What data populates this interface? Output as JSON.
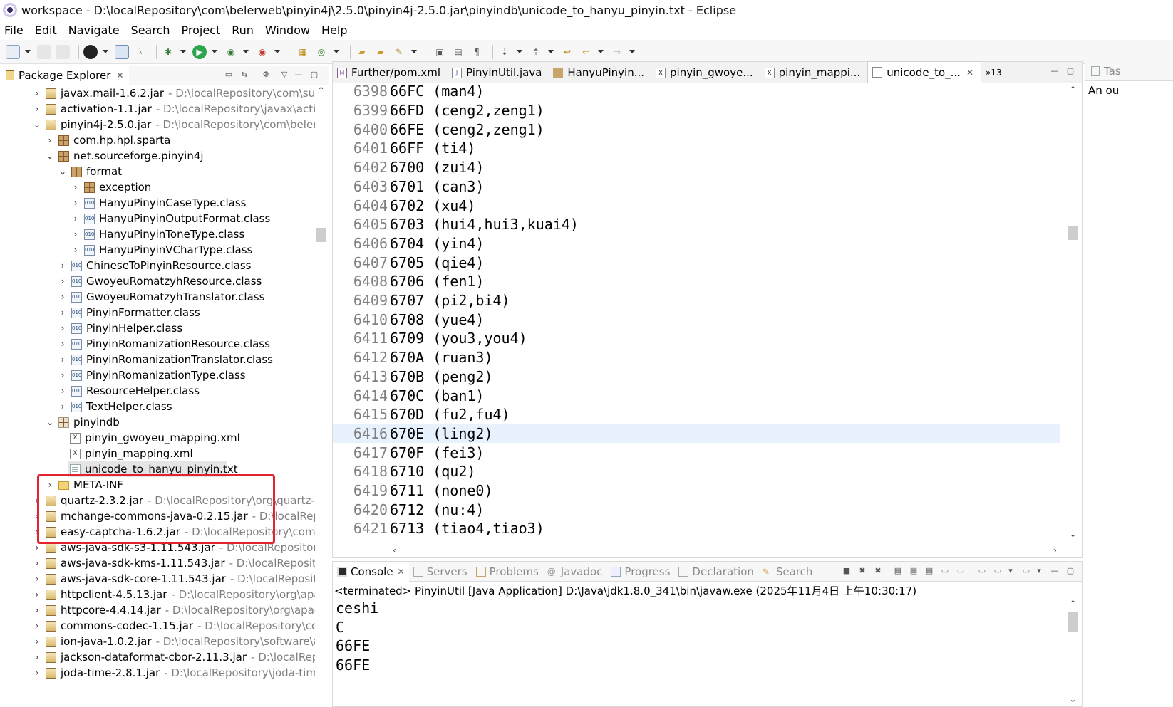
{
  "window": {
    "title": "workspace - D:\\localRepository\\com\\belerweb\\pinyin4j\\2.5.0\\pinyin4j-2.5.0.jar\\pinyindb\\unicode_to_hanyu_pinyin.txt - Eclipse"
  },
  "menu": [
    "File",
    "Edit",
    "Navigate",
    "Search",
    "Project",
    "Run",
    "Window",
    "Help"
  ],
  "package_explorer": {
    "title": "Package Explorer",
    "rows": [
      {
        "label": "javax.mail-1.6.2.jar",
        "path": "- D:\\localRepository\\com\\sun\\ma"
      },
      {
        "label": "activation-1.1.jar",
        "path": "- D:\\localRepository\\javax\\activatio"
      },
      {
        "label": "pinyin4j-2.5.0.jar",
        "path": "- D:\\localRepository\\com\\belerwel"
      },
      {
        "label": "com.hp.hpl.sparta",
        "path": ""
      },
      {
        "label": "net.sourceforge.pinyin4j",
        "path": ""
      },
      {
        "label": "format",
        "path": ""
      },
      {
        "label": "exception",
        "path": ""
      },
      {
        "label": "HanyuPinyinCaseType.class",
        "path": ""
      },
      {
        "label": "HanyuPinyinOutputFormat.class",
        "path": ""
      },
      {
        "label": "HanyuPinyinToneType.class",
        "path": ""
      },
      {
        "label": "HanyuPinyinVCharType.class",
        "path": ""
      },
      {
        "label": "ChineseToPinyinResource.class",
        "path": ""
      },
      {
        "label": "GwoyeuRomatzyhResource.class",
        "path": ""
      },
      {
        "label": "GwoyeuRomatzyhTranslator.class",
        "path": ""
      },
      {
        "label": "PinyinFormatter.class",
        "path": ""
      },
      {
        "label": "PinyinHelper.class",
        "path": ""
      },
      {
        "label": "PinyinRomanizationResource.class",
        "path": ""
      },
      {
        "label": "PinyinRomanizationTranslator.class",
        "path": ""
      },
      {
        "label": "PinyinRomanizationType.class",
        "path": ""
      },
      {
        "label": "ResourceHelper.class",
        "path": ""
      },
      {
        "label": "TextHelper.class",
        "path": ""
      },
      {
        "label": "pinyindb",
        "path": ""
      },
      {
        "label": "pinyin_gwoyeu_mapping.xml",
        "path": ""
      },
      {
        "label": "pinyin_mapping.xml",
        "path": ""
      },
      {
        "label": "unicode_to_hanyu_pinyin.txt",
        "path": ""
      },
      {
        "label": "META-INF",
        "path": ""
      },
      {
        "label": "quartz-2.3.2.jar",
        "path": "- D:\\localRepository\\org\\quartz-sche"
      },
      {
        "label": "mchange-commons-java-0.2.15.jar",
        "path": "- D:\\localReposit"
      },
      {
        "label": "easy-captcha-1.6.2.jar",
        "path": "- D:\\localRepository\\com\\gitl"
      },
      {
        "label": "aws-java-sdk-s3-1.11.543.jar",
        "path": "- D:\\localRepository\\cc"
      },
      {
        "label": "aws-java-sdk-kms-1.11.543.jar",
        "path": "- D:\\localRepository\\c"
      },
      {
        "label": "aws-java-sdk-core-1.11.543.jar",
        "path": "- D:\\localRepository\\"
      },
      {
        "label": "httpclient-4.5.13.jar",
        "path": "- D:\\localRepository\\org\\apach"
      },
      {
        "label": "httpcore-4.4.14.jar",
        "path": "- D:\\localRepository\\org\\apache"
      },
      {
        "label": "commons-codec-1.15.jar",
        "path": "- D:\\localRepository\\comr"
      },
      {
        "label": "ion-java-1.0.2.jar",
        "path": "- D:\\localRepository\\software\\ama"
      },
      {
        "label": "jackson-dataformat-cbor-2.11.3.jar",
        "path": "- D:\\localReposi"
      },
      {
        "label": "joda-time-2.8.1.jar",
        "path": "- D:\\localRepository\\joda-time\\jc"
      }
    ]
  },
  "editor": {
    "tabs": [
      "Further/pom.xml",
      "PinyinUtil.java",
      "HanyuPinyin...",
      "pinyin_gwoye...",
      "pinyin_mappi...",
      "unicode_to_..."
    ],
    "overflow": "»13",
    "lines": [
      {
        "n": "6398",
        "t": "66FC (man4)"
      },
      {
        "n": "6399",
        "t": "66FD (ceng2,zeng1)"
      },
      {
        "n": "6400",
        "t": "66FE (ceng2,zeng1)"
      },
      {
        "n": "6401",
        "t": "66FF (ti4)"
      },
      {
        "n": "6402",
        "t": "6700 (zui4)"
      },
      {
        "n": "6403",
        "t": "6701 (can3)"
      },
      {
        "n": "6404",
        "t": "6702 (xu4)"
      },
      {
        "n": "6405",
        "t": "6703 (hui4,hui3,kuai4)"
      },
      {
        "n": "6406",
        "t": "6704 (yin4)"
      },
      {
        "n": "6407",
        "t": "6705 (qie4)"
      },
      {
        "n": "6408",
        "t": "6706 (fen1)"
      },
      {
        "n": "6409",
        "t": "6707 (pi2,bi4)"
      },
      {
        "n": "6410",
        "t": "6708 (yue4)"
      },
      {
        "n": "6411",
        "t": "6709 (you3,you4)"
      },
      {
        "n": "6412",
        "t": "670A (ruan3)"
      },
      {
        "n": "6413",
        "t": "670B (peng2)"
      },
      {
        "n": "6414",
        "t": "670C (ban1)"
      },
      {
        "n": "6415",
        "t": "670D (fu2,fu4)"
      },
      {
        "n": "6416",
        "t": "670E (ling2)"
      },
      {
        "n": "6417",
        "t": "670F (fei3)"
      },
      {
        "n": "6418",
        "t": "6710 (qu2)"
      },
      {
        "n": "6419",
        "t": "6711 (none0)"
      },
      {
        "n": "6420",
        "t": "6712 (nu:4)"
      },
      {
        "n": "6421",
        "t": "6713 (tiao4,tiao3)"
      }
    ]
  },
  "right_pane": {
    "tab": "Tas",
    "text": "An ou"
  },
  "console": {
    "tabs": [
      "Console",
      "Servers",
      "Problems",
      "Javadoc",
      "Progress",
      "Declaration",
      "Search"
    ],
    "status": "<terminated> PinyinUtil [Java Application] D:\\Java\\jdk1.8.0_341\\bin\\javaw.exe (2025年11月4日 上午10:30:17)",
    "output": [
      "ceshi",
      "C",
      "66FE",
      "66FE"
    ]
  }
}
